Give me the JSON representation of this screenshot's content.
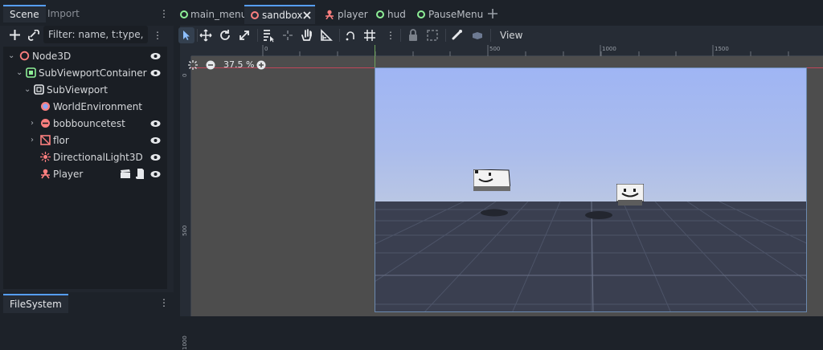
{
  "left_dock": {
    "tabs": [
      "Scene",
      "Import"
    ],
    "filter_placeholder": "Filter: name, t:type,",
    "tree": [
      {
        "label": "Node3D",
        "icon": "node3d-icon"
      },
      {
        "label": "SubViewportContainer",
        "icon": "subviewport-container-icon"
      },
      {
        "label": "SubViewport",
        "icon": "subviewport-icon"
      },
      {
        "label": "WorldEnvironment",
        "icon": "world-environment-icon"
      },
      {
        "label": "bobbouncetest",
        "icon": "instanced-scene-icon"
      },
      {
        "label": "flor",
        "icon": "mesh-instance-icon"
      },
      {
        "label": "DirectionalLight3D",
        "icon": "directional-light-icon"
      },
      {
        "label": "Player",
        "icon": "character-body-icon"
      }
    ],
    "bottom_tab": "FileSystem"
  },
  "scene_tabs": {
    "tabs": [
      "main_menu",
      "sandbox",
      "player",
      "hud",
      "PauseMenu"
    ],
    "active": "sandbox"
  },
  "toolbar": {
    "view_label": "View"
  },
  "rulers": {
    "top": [
      "0",
      "500",
      "1000",
      "1500"
    ],
    "left": [
      "0",
      "500",
      "1000"
    ]
  },
  "zoom": {
    "value": "37.5 %"
  },
  "colors": {
    "accent": "#569eff",
    "scene_ring": "#8eef97",
    "node_red": "#fc7f7f",
    "sky_top": "#9fb5f4",
    "ground": "#3a3f50"
  }
}
